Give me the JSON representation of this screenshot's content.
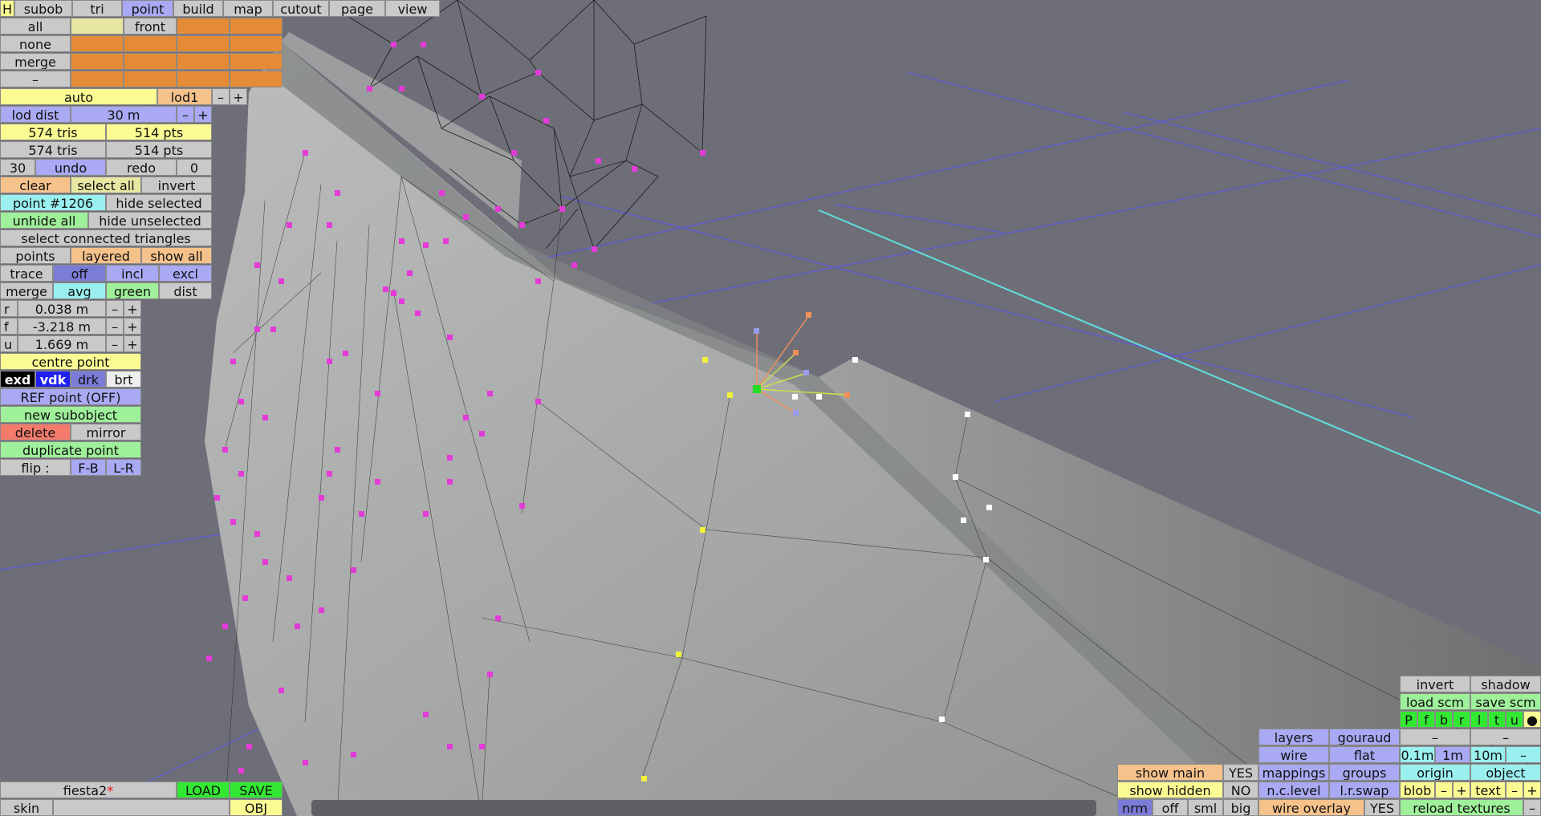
{
  "menu": {
    "h": "H",
    "subob": "subob",
    "tri": "tri",
    "point": "point",
    "build": "build",
    "map": "map",
    "cutout": "cutout",
    "page": "page",
    "view": "view"
  },
  "selection": {
    "all": "all",
    "front": "front",
    "none": "none",
    "merge": "merge",
    "minus": "–"
  },
  "lod": {
    "auto": "auto",
    "name": "lod1",
    "minus": "–",
    "plus": "+",
    "dist_label": "lod dist",
    "dist_value": "30 m"
  },
  "counts": {
    "tris_1": "574 tris",
    "pts_1": "514 pts",
    "tris_2": "574 tris",
    "pts_2": "514 pts"
  },
  "history": {
    "undo_count": "30",
    "undo": "undo",
    "redo": "redo",
    "redo_count": "0"
  },
  "sel_actions": {
    "clear": "clear",
    "select_all": "select all",
    "invert": "invert"
  },
  "point_info": {
    "point_id": "point #1206",
    "hide_selected": "hide selected",
    "unhide_all": "unhide all",
    "hide_unselected": "hide unselected",
    "select_connected": "select connected triangles"
  },
  "display": {
    "points": "points",
    "layered": "layered",
    "show_all": "show all"
  },
  "trace": {
    "label": "trace",
    "off": "off",
    "incl": "incl",
    "excl": "excl"
  },
  "merge_row": {
    "merge": "merge",
    "avg": "avg",
    "green": "green",
    "dist": "dist"
  },
  "coords": {
    "r_label": "r",
    "r_value": "0.038 m",
    "f_label": "f",
    "f_value": "-3.218 m",
    "u_label": "u",
    "u_value": "1.669 m",
    "minus": "–",
    "plus": "+"
  },
  "tools": {
    "centre_point": "centre point",
    "exd": "exd",
    "vdk": "vdk",
    "drk": "drk",
    "brt": "brt",
    "ref_point": "REF point (OFF)",
    "new_subobject": "new subobject",
    "delete": "delete",
    "mirror": "mirror",
    "duplicate_point": "duplicate point",
    "flip": "flip :",
    "fb": "F-B",
    "lr": "L-R"
  },
  "file": {
    "name": "fiesta2",
    "modified_mark": "*",
    "load": "LOAD",
    "save": "SAVE",
    "skin": "skin",
    "obj": "OBJ"
  },
  "view_panel": {
    "invert": "invert",
    "shadow": "shadow",
    "load_scm": "load scm",
    "save_scm": "save scm",
    "views": [
      "P",
      "f",
      "b",
      "r",
      "l",
      "t",
      "u",
      "●"
    ],
    "dash": "–",
    "layers": "layers",
    "gouraud": "gouraud",
    "wire": "wire",
    "flat": "flat",
    "step_01": "0.1m",
    "step_1": "1m",
    "step_10": "10m",
    "step_minus": "–",
    "show_main": "show main",
    "show_main_val": "YES",
    "mappings": "mappings",
    "groups": "groups",
    "origin": "origin",
    "object": "object",
    "show_hidden": "show hidden",
    "show_hidden_val": "NO",
    "nc_level": "n.c.level",
    "lr_swap": "l.r.swap",
    "blob": "blob",
    "text": "text",
    "minus": "–",
    "plus": "+",
    "nrm": "nrm",
    "off": "off",
    "sml": "sml",
    "big": "big",
    "wire_overlay": "wire overlay",
    "wire_overlay_val": "YES",
    "reload_textures": "reload textures"
  }
}
